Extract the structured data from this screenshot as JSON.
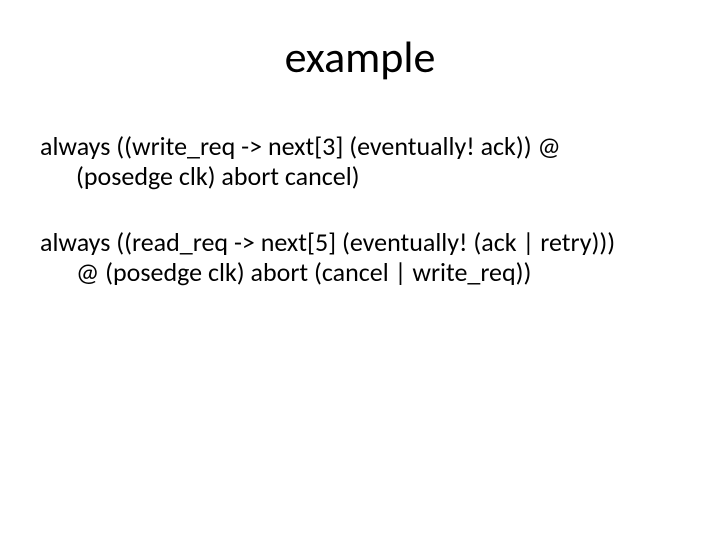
{
  "title": "example",
  "assertions": [
    {
      "line1": "always ((write_req -> next[3] (eventually! ack)) @",
      "line2": "(posedge clk) abort cancel)"
    },
    {
      "line1": "always ((read_req -> next[5] (eventually! (ack | retry)))",
      "line2": "@ (posedge clk) abort (cancel | write_req))"
    }
  ]
}
